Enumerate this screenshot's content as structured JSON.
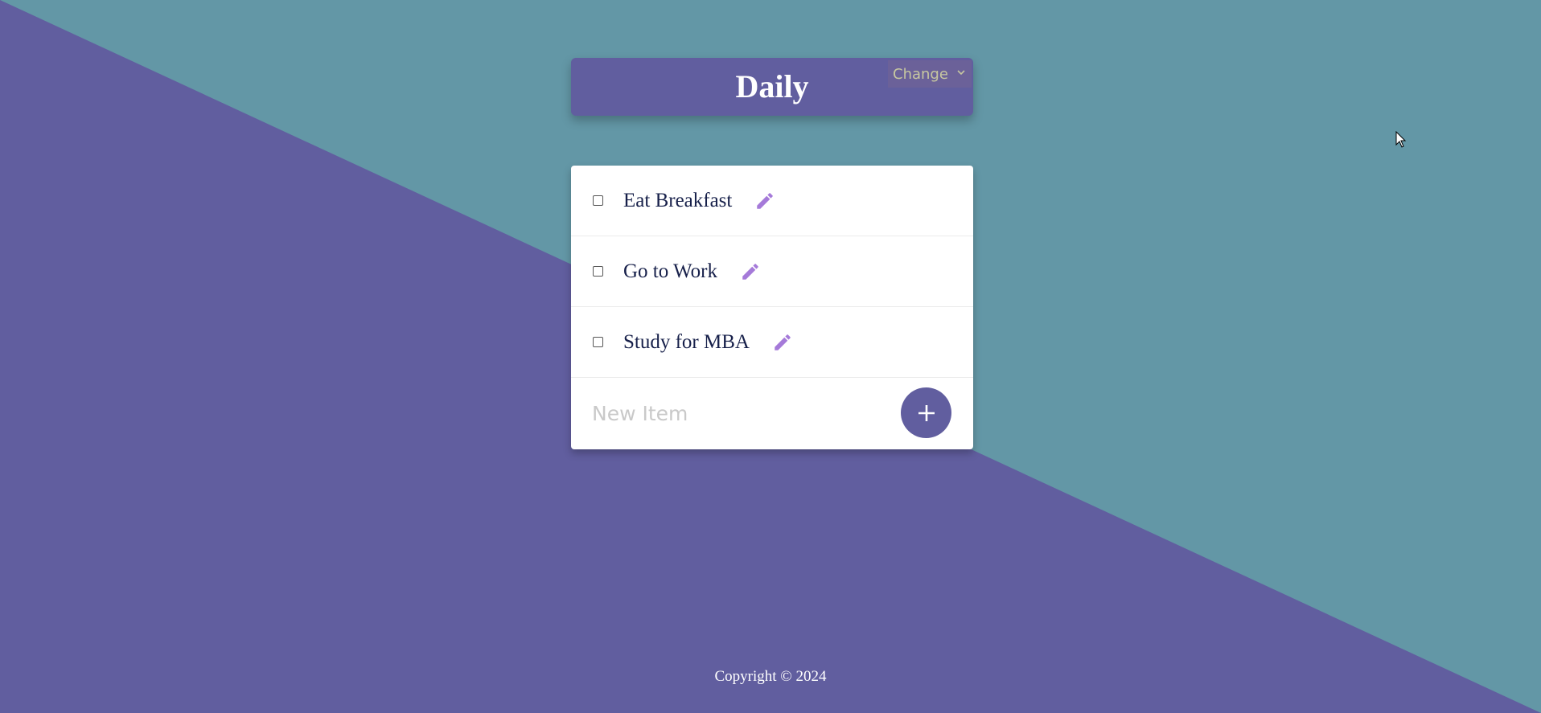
{
  "colors": {
    "background_teal": "#6397a6",
    "background_purple": "#615e9f",
    "accent": "#615e9f",
    "edit_icon": "#a57ad9",
    "item_text": "#17204a"
  },
  "header": {
    "title": "Daily",
    "list_select": {
      "selected": "Change",
      "icon": "chevron-down-icon"
    }
  },
  "items": [
    {
      "label": "Eat Breakfast",
      "checked": false,
      "icon": "pencil-icon"
    },
    {
      "label": "Go to Work",
      "checked": false,
      "icon": "pencil-icon"
    },
    {
      "label": "Study for MBA",
      "checked": false,
      "icon": "pencil-icon"
    }
  ],
  "new_item": {
    "placeholder": "New Item",
    "value": "",
    "add_icon": "plus-icon"
  },
  "footer": {
    "copyright": "Copyright © 2024"
  }
}
